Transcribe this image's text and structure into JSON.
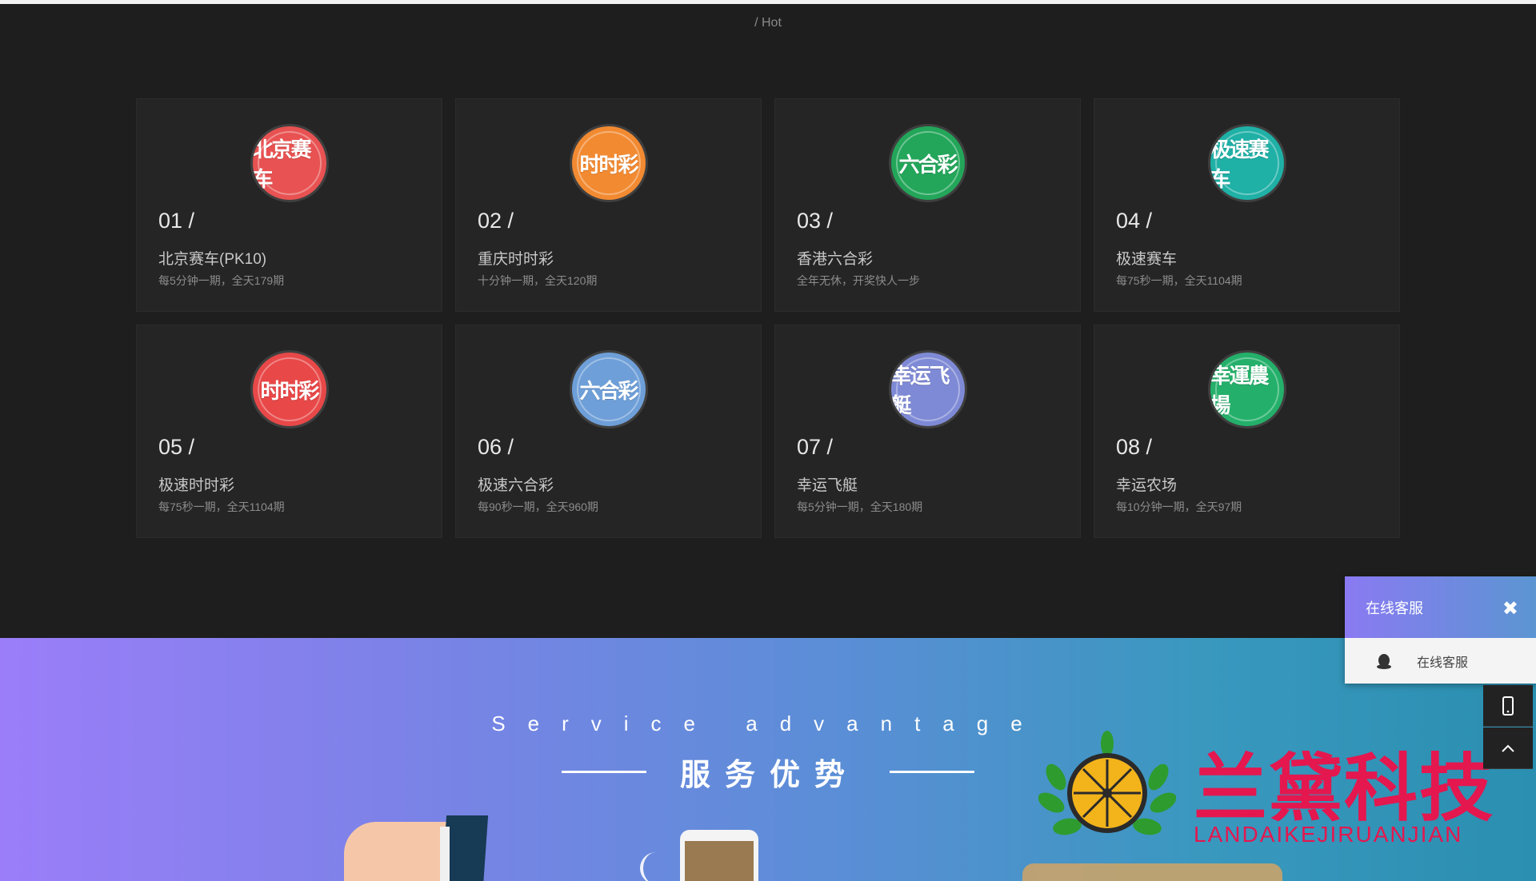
{
  "breadcrumb": "/ Hot",
  "games": [
    {
      "num": "01 /",
      "title": "北京赛车(PK10)",
      "desc": "每5分钟一期，全天179期",
      "logo_text": "北京赛车",
      "color": "#e85252"
    },
    {
      "num": "02 /",
      "title": "重庆时时彩",
      "desc": "十分钟一期，全天120期",
      "logo_text": "时时彩",
      "color": "#f28a32"
    },
    {
      "num": "03 /",
      "title": "香港六合彩",
      "desc": "全年无休，开奖快人一步",
      "logo_text": "六合彩",
      "color": "#23a65a"
    },
    {
      "num": "04 /",
      "title": "极速赛车",
      "desc": "每75秒一期，全天1104期",
      "logo_text": "极速赛车",
      "color": "#1fb0a6"
    },
    {
      "num": "05 /",
      "title": "极速时时彩",
      "desc": "每75秒一期，全天1104期",
      "logo_text": "时时彩",
      "color": "#e84848"
    },
    {
      "num": "06 /",
      "title": "极速六合彩",
      "desc": "每90秒一期，全天960期",
      "logo_text": "六合彩",
      "color": "#6e9fd8"
    },
    {
      "num": "07 /",
      "title": "幸运飞艇",
      "desc": "每5分钟一期，全天180期",
      "logo_text": "幸运飞艇",
      "color": "#7f8ad6"
    },
    {
      "num": "08 /",
      "title": "幸运农场",
      "desc": "每10分钟一期，全天97期",
      "logo_text": "幸運農場",
      "color": "#24b06a"
    }
  ],
  "service": {
    "en": "Service advantage",
    "cn": "服务优势"
  },
  "watermark": {
    "cn": "兰黛科技",
    "en": "LANDAIKEJIRUANJIAN"
  },
  "customer_service": {
    "title": "在线客服",
    "item_label": "在线客服",
    "close_icon": "close-icon",
    "qq_icon": "qq-penguin-icon"
  },
  "side_buttons": [
    "mobile-icon",
    "chevron-up-icon"
  ]
}
